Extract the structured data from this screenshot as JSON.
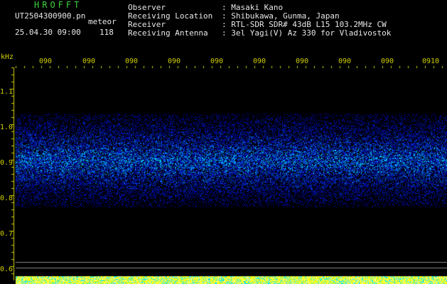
{
  "app": {
    "logo": "HROFFT",
    "filename": "UT2504300900.pn",
    "mode_label": "meteor",
    "date_time": "25.04.30 09:00",
    "count": "118"
  },
  "info": [
    {
      "label": "Observer",
      "value": ": Masaki Kano"
    },
    {
      "label": "Receiving Location",
      "value": ": Shibukawa, Gunma, Japan"
    },
    {
      "label": "Receiver",
      "value": ": RTL-SDR SDR# 43dB L15 103.2MHz CW"
    },
    {
      "label": "Receiving Antenna",
      "value": ": 3el Yagi(V) Az 330 for Vladivostok"
    }
  ],
  "spectrogram": {
    "y_unit": "kHz",
    "y_ticks": [
      "1.1",
      "1.0",
      "0.9",
      "0.8",
      "0.7",
      "0.6"
    ],
    "x_ticks": [
      "090",
      "090",
      "090",
      "090",
      "090",
      "090",
      "090",
      "090",
      "090",
      "0910"
    ],
    "colors": {
      "axis": "#d0d000",
      "signal_low": "#0000a0",
      "signal_high": "#00e0ff",
      "baseline": "#888888"
    }
  }
}
